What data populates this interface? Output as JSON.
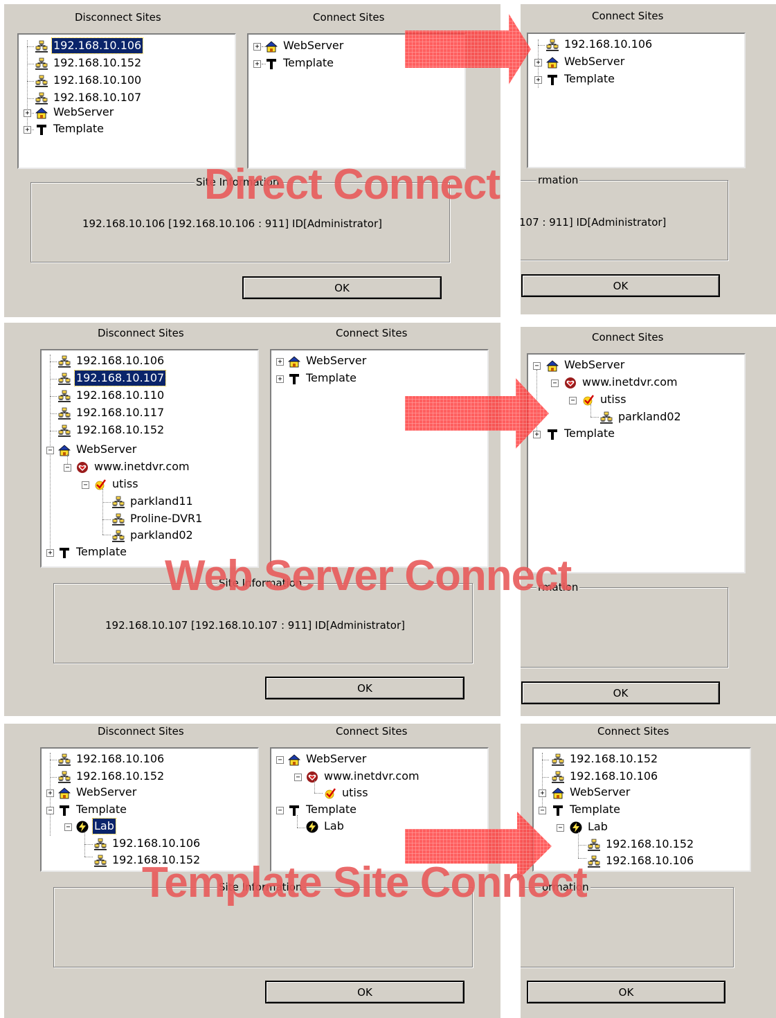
{
  "colors": {
    "panel": "#d4d0c8",
    "selection": "#0a246a",
    "overlay": "#ee4444"
  },
  "icons": {
    "site": "computer-network-icon",
    "webserver": "house-icon",
    "template": "letter-t-icon",
    "domain": "heart-icon",
    "user": "checkmark-icon",
    "group": "lightning-icon"
  },
  "row1": {
    "disconnect_label": "Disconnect Sites",
    "connect_label": "Connect Sites",
    "disconnect": [
      "192.168.10.106",
      "192.168.10.152",
      "192.168.10.100",
      "192.168.10.107",
      "WebServer",
      "Template"
    ],
    "connect": [
      "WebServer",
      "Template"
    ],
    "result_label": "Connect Sites",
    "result": [
      "192.168.10.106",
      "WebServer",
      "Template"
    ],
    "site_info_label": "Site Information",
    "site_info_text": "192.168.10.106 [192.168.10.106 : 911]  ID[Administrator]",
    "result_info_label": "rmation",
    "result_info_text": "107 : 911]  ID[Administrator]",
    "ok": "OK",
    "caption": "Direct Connect"
  },
  "row2": {
    "disconnect_label": "Disconnect Sites",
    "connect_label": "Connect Sites",
    "disconnect": [
      "192.168.10.106",
      "192.168.10.107",
      "192.168.10.110",
      "192.168.10.117",
      "192.168.10.152",
      "WebServer",
      "www.inetdvr.com",
      "utiss",
      "parkland11",
      "Proline-DVR1",
      "parkland02",
      "Template"
    ],
    "connect": [
      "WebServer",
      "Template"
    ],
    "result_label": "Connect Sites",
    "result": [
      "WebServer",
      "www.inetdvr.com",
      "utiss",
      "parkland02",
      "Template"
    ],
    "site_info_label": "Site Information",
    "site_info_text": "192.168.10.107 [192.168.10.107 : 911]  ID[Administrator]",
    "result_info_label": "rmation",
    "ok": "OK",
    "caption": "Web Server Connect"
  },
  "row3": {
    "disconnect_label": "Disconnect Sites",
    "connect_label": "Connect Sites",
    "disconnect": [
      "192.168.10.106",
      "192.168.10.152",
      "WebServer",
      "Template",
      "Lab",
      "192.168.10.106",
      "192.168.10.152"
    ],
    "connect": [
      "WebServer",
      "www.inetdvr.com",
      "utiss",
      "Template",
      "Lab"
    ],
    "result_label": "Connect Sites",
    "result": [
      "192.168.10.152",
      "192.168.10.106",
      "WebServer",
      "Template",
      "Lab",
      "192.168.10.152",
      "192.168.10.106"
    ],
    "site_info_label": "Site Information",
    "result_info_label": "ormation",
    "ok": "OK",
    "caption": "Template Site Connect"
  }
}
